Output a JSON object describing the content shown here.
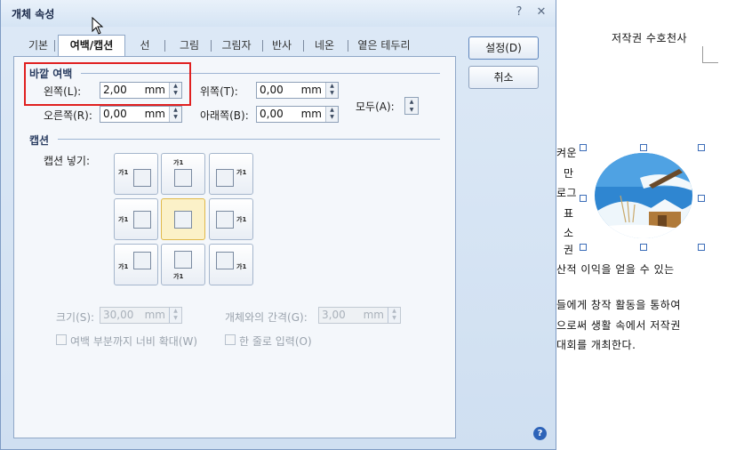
{
  "dialog": {
    "title": "개체 속성",
    "help_icon": "?",
    "close_icon": "✕"
  },
  "tabs": [
    "기본",
    "여백/캡션",
    "선",
    "그림",
    "그림자",
    "반사",
    "네온",
    "옅은 테두리"
  ],
  "outer_margin": {
    "title": "바깥 여백",
    "left": {
      "label": "왼쪽(L):",
      "value": "2,00",
      "unit": "mm"
    },
    "top": {
      "label": "위쪽(T):",
      "value": "0,00",
      "unit": "mm"
    },
    "right": {
      "label": "오른쪽(R):",
      "value": "0,00",
      "unit": "mm"
    },
    "bottom": {
      "label": "아래쪽(B):",
      "value": "0,00",
      "unit": "mm"
    },
    "all_label": "모두(A):"
  },
  "caption": {
    "title": "캡션",
    "insert_label": "캡션 넣기:",
    "glyph": "가1",
    "size": {
      "label": "크기(S):",
      "value": "30,00",
      "unit": "mm"
    },
    "gap": {
      "label": "개체와의 간격(G):",
      "value": "3,00",
      "unit": "mm"
    },
    "extend_label": "여백 부분까지 너비 확대(W)",
    "single_line_label": "한 줄로 입력(O)"
  },
  "buttons": {
    "ok": "설정(D)",
    "cancel": "취소",
    "help": "?"
  },
  "document": {
    "header": "저작권 수호천사",
    "side_chars": [
      "켜운",
      "만",
      "로그",
      "표",
      "소",
      "권"
    ],
    "lines": [
      "산적 이익을 얻을 수 있는",
      "들에게 창작 활동을 통하여",
      "으로써 생활 속에서 저작권",
      "대회를 개최한다."
    ]
  },
  "colors": {
    "accent": "#2d63b8",
    "highlight_box": "#e02020",
    "selected_cell": "#fbf1c8"
  }
}
